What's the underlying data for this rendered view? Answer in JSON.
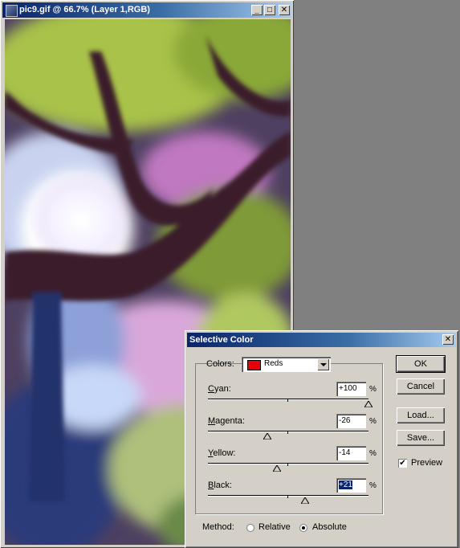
{
  "document_window": {
    "title": "pic9.gif @ 66.7% (Layer 1,RGB)",
    "controls": {
      "minimize": "_",
      "maximize": "□",
      "close": "✕"
    }
  },
  "dialog": {
    "title": "Selective Color",
    "close": "✕",
    "colors_label": "Colors:",
    "selected_color": {
      "name": "Reds",
      "swatch": "#e8000a"
    },
    "sliders": [
      {
        "label": "Cyan:",
        "accel": "C",
        "value": "+100",
        "percent": 100,
        "unit": "%"
      },
      {
        "label": "Magenta:",
        "accel": "M",
        "value": "-26",
        "percent": -26,
        "unit": "%"
      },
      {
        "label": "Yellow:",
        "accel": "Y",
        "value": "-14",
        "percent": -14,
        "unit": "%"
      },
      {
        "label": "Black:",
        "accel": "B",
        "value": "+21",
        "percent": 21,
        "unit": "%"
      }
    ],
    "buttons": {
      "ok": "OK",
      "cancel": "Cancel",
      "load": "Load...",
      "save": "Save..."
    },
    "preview": {
      "label": "Preview",
      "checked": true,
      "check_glyph": "✔"
    },
    "method": {
      "label": "Method:",
      "options": [
        {
          "label": "Relative",
          "selected": false
        },
        {
          "label": "Absolute",
          "selected": true
        }
      ]
    }
  }
}
